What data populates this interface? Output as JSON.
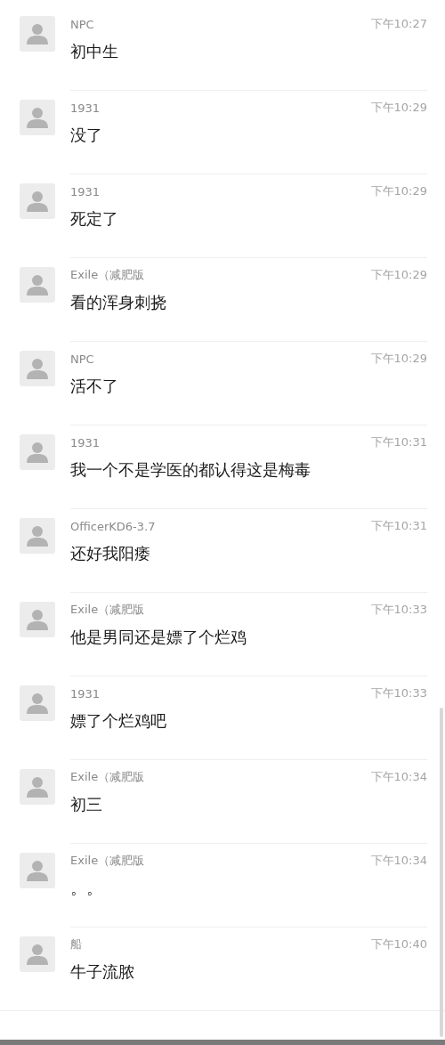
{
  "messages": [
    {
      "name": "NPC",
      "time": "下午10:27",
      "text": "初中生"
    },
    {
      "name": "1931",
      "time": "下午10:29",
      "text": "没了"
    },
    {
      "name": "1931",
      "time": "下午10:29",
      "text": "死定了"
    },
    {
      "name": "Exile（减肥版",
      "time": "下午10:29",
      "text": "看的浑身刺挠"
    },
    {
      "name": "NPC",
      "time": "下午10:29",
      "text": "活不了"
    },
    {
      "name": "1931",
      "time": "下午10:31",
      "text": "我一个不是学医的都认得这是梅毒"
    },
    {
      "name": "OfficerKD6-3.7",
      "time": "下午10:31",
      "text": "还好我阳痿"
    },
    {
      "name": "Exile（减肥版",
      "time": "下午10:33",
      "text": "他是男同还是嫖了个烂鸡"
    },
    {
      "name": "1931",
      "time": "下午10:33",
      "text": "嫖了个烂鸡吧"
    },
    {
      "name": "Exile（减肥版",
      "time": "下午10:34",
      "text": "初三"
    },
    {
      "name": "Exile（减肥版",
      "time": "下午10:34",
      "text": "。。"
    },
    {
      "name": "船",
      "time": "下午10:40",
      "text": "牛子流脓"
    }
  ]
}
